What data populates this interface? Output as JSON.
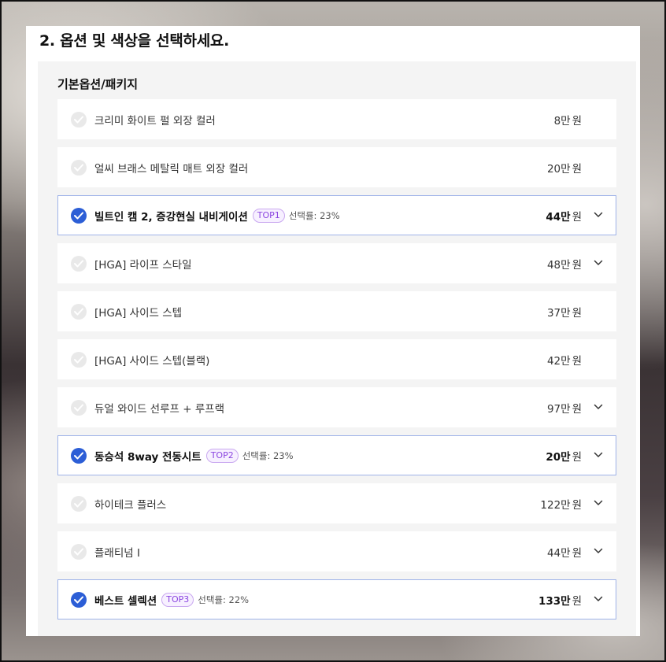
{
  "section": {
    "title": "2. 옵션 및 색상을 선택하세요."
  },
  "group": {
    "title": "기본옵션/패키지"
  },
  "options": [
    {
      "name": "크리미 화이트 펄 외장 컬러",
      "price": "8만",
      "unit": "원",
      "selected": false,
      "badge": "",
      "rate": "",
      "expandable": false
    },
    {
      "name": "얼씨 브래스 메탈릭 매트 외장 컬러",
      "price": "20만",
      "unit": "원",
      "selected": false,
      "badge": "",
      "rate": "",
      "expandable": false
    },
    {
      "name": "빌트인 캠 2, 증강현실 내비게이션",
      "price": "44만",
      "unit": "원",
      "selected": true,
      "badge": "TOP1",
      "rate": "선택률: 23%",
      "expandable": true
    },
    {
      "name": "[HGA] 라이프 스타일",
      "price": "48만",
      "unit": "원",
      "selected": false,
      "badge": "",
      "rate": "",
      "expandable": true
    },
    {
      "name": "[HGA] 사이드 스텝",
      "price": "37만",
      "unit": "원",
      "selected": false,
      "badge": "",
      "rate": "",
      "expandable": false
    },
    {
      "name": "[HGA] 사이드 스텝(블랙)",
      "price": "42만",
      "unit": "원",
      "selected": false,
      "badge": "",
      "rate": "",
      "expandable": false
    },
    {
      "name": "듀얼 와이드 선루프 + 루프랙",
      "price": "97만",
      "unit": "원",
      "selected": false,
      "badge": "",
      "rate": "",
      "expandable": true
    },
    {
      "name": "동승석 8way 전동시트",
      "price": "20만",
      "unit": "원",
      "selected": true,
      "badge": "TOP2",
      "rate": "선택률: 23%",
      "expandable": true
    },
    {
      "name": "하이테크 플러스",
      "price": "122만",
      "unit": "원",
      "selected": false,
      "badge": "",
      "rate": "",
      "expandable": true
    },
    {
      "name": "플래티넘 I",
      "price": "44만",
      "unit": "원",
      "selected": false,
      "badge": "",
      "rate": "",
      "expandable": true
    },
    {
      "name": "베스트 셀렉션",
      "price": "133만",
      "unit": "원",
      "selected": true,
      "badge": "TOP3",
      "rate": "선택률: 22%",
      "expandable": true
    }
  ],
  "colors": {
    "selected_check": "#2c5ed6",
    "selected_border": "#9fb3e8",
    "badge_text": "#8b45e0",
    "unselected_check": "#e9e9e9"
  },
  "icons": {
    "check": "check-icon",
    "expand": "chevron-down-icon"
  }
}
